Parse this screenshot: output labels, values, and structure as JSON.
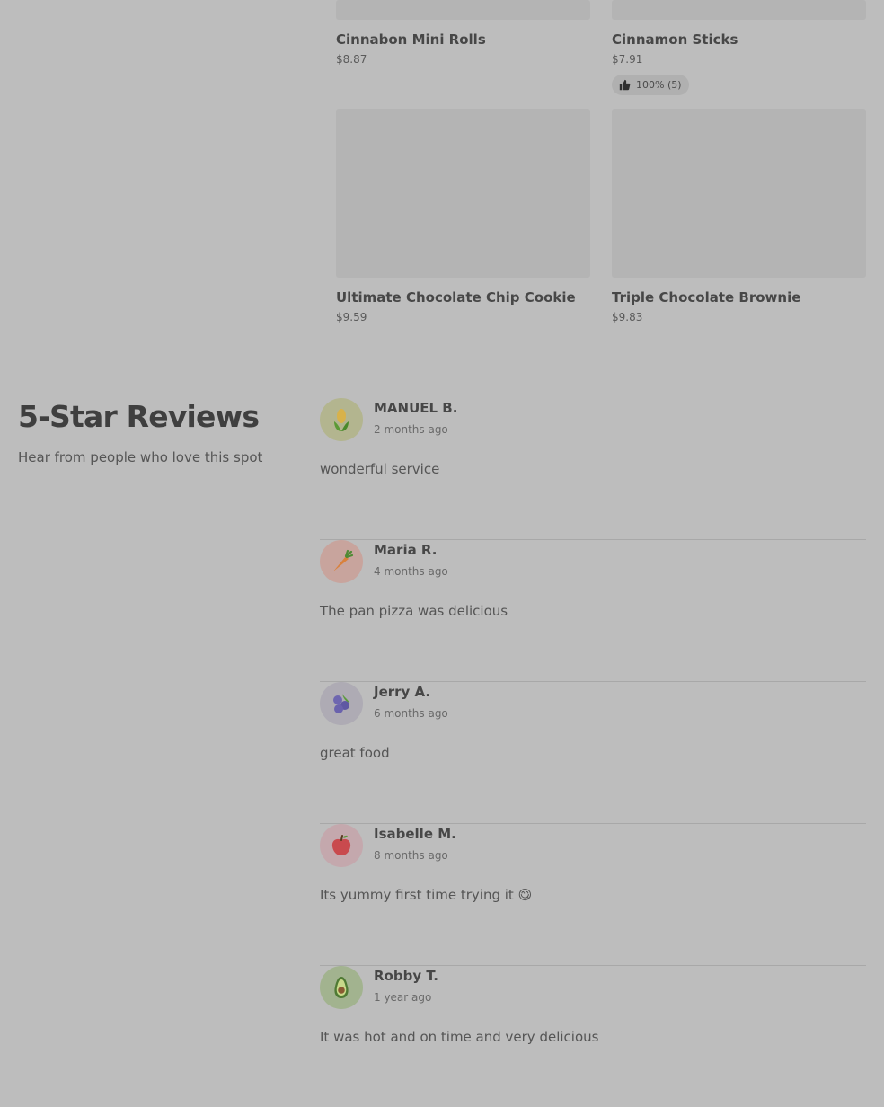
{
  "products": [
    {
      "name": "Cinnabon Mini Rolls",
      "price": "$8.87"
    },
    {
      "name": "Cinnamon Sticks",
      "price": "$7.91",
      "rating": "100% (5)"
    },
    {
      "name": "Ultimate Chocolate Chip Cookie",
      "price": "$9.59"
    },
    {
      "name": "Triple Chocolate Brownie",
      "price": "$9.83"
    }
  ],
  "reviews_section": {
    "title": "5-Star Reviews",
    "subtitle": "Hear from people who love this spot"
  },
  "reviews": [
    {
      "name": "MANUEL B.",
      "date": "2 months ago",
      "text": "wonderful service",
      "avatar": "corn-icon",
      "avatar_bg": "#b3b58f"
    },
    {
      "name": "Maria R.",
      "date": "4 months ago",
      "text": "The pan pizza was delicious",
      "avatar": "carrot-icon",
      "avatar_bg": "#c8a49d"
    },
    {
      "name": "Jerry A.",
      "date": "6 months ago",
      "text": "great food",
      "avatar": "blueberry-icon",
      "avatar_bg": "#aeabb4"
    },
    {
      "name": "Isabelle M.",
      "date": "8 months ago",
      "text": "Its yummy first time trying it 😋",
      "avatar": "apple-icon",
      "avatar_bg": "#c4a8ad"
    },
    {
      "name": "Robby T.",
      "date": "1 year ago",
      "text": "It was hot and on time and very delicious",
      "avatar": "avocado-icon",
      "avatar_bg": "#a2b38f"
    }
  ],
  "colors": {
    "background": "#bdbdbd",
    "image_placeholder": "#b4b4b4",
    "divider": "#a8a8a8"
  }
}
